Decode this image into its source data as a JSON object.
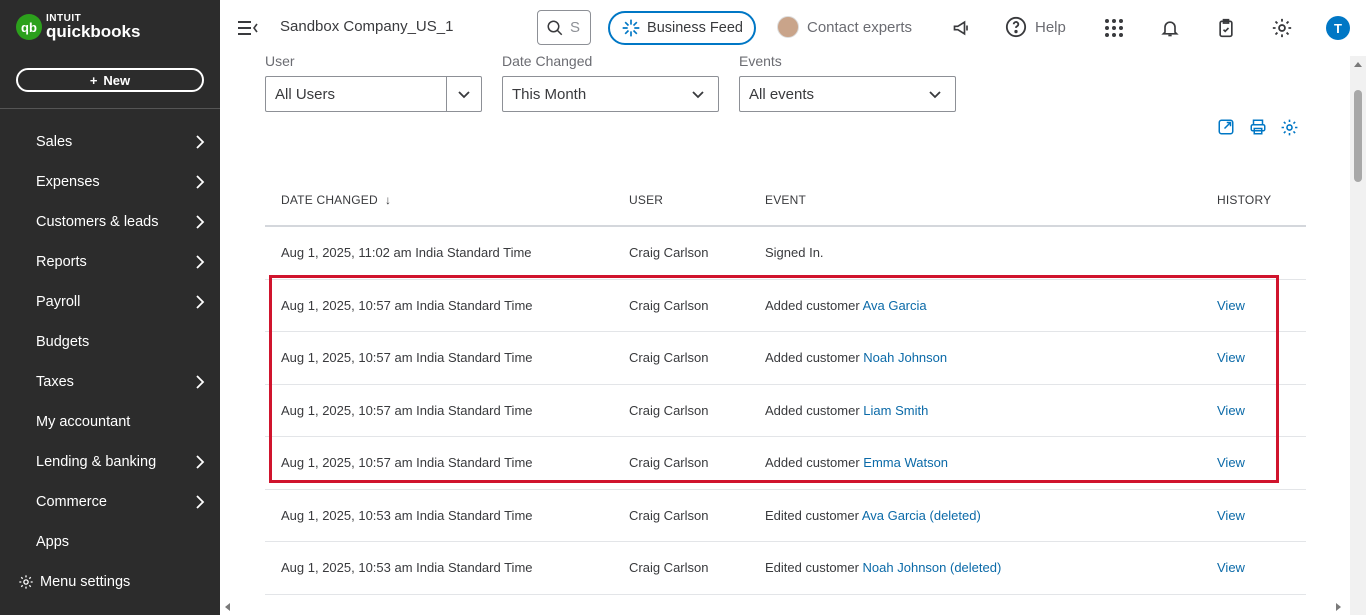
{
  "brand": {
    "logo_mark": "qb",
    "logo_intuit": "INTUIT",
    "logo_name": "quickbooks"
  },
  "sidebar": {
    "new_label": "New",
    "items": [
      {
        "label": "Sales",
        "chevron": true
      },
      {
        "label": "Expenses",
        "chevron": true
      },
      {
        "label": "Customers & leads",
        "chevron": true
      },
      {
        "label": "Reports",
        "chevron": true
      },
      {
        "label": "Payroll",
        "chevron": true
      },
      {
        "label": "Budgets",
        "chevron": false
      },
      {
        "label": "Taxes",
        "chevron": true
      },
      {
        "label": "My accountant",
        "chevron": false
      },
      {
        "label": "Lending & banking",
        "chevron": true
      },
      {
        "label": "Commerce",
        "chevron": true
      },
      {
        "label": "Apps",
        "chevron": false
      }
    ],
    "menu_settings": "Menu settings"
  },
  "header": {
    "company": "Sandbox Company_US_1",
    "search_placeholder": "S",
    "business_feed": "Business Feed",
    "contact_experts": "Contact experts",
    "help": "Help",
    "user_initial": "T"
  },
  "filters": {
    "user_label": "User",
    "user_value": "All Users",
    "date_label": "Date Changed",
    "date_value": "This Month",
    "events_label": "Events",
    "events_value": "All events"
  },
  "table": {
    "headers": {
      "date": "DATE CHANGED",
      "sort_arrow": "↓",
      "user": "USER",
      "event": "EVENT",
      "history": "HISTORY"
    },
    "rows": [
      {
        "date": "Aug 1, 2025, 11:02 am India Standard Time",
        "user": "Craig Carlson",
        "event_prefix": "Signed In.",
        "event_link": "",
        "history": ""
      },
      {
        "date": "Aug 1, 2025, 10:57 am India Standard Time",
        "user": "Craig Carlson",
        "event_prefix": "Added customer ",
        "event_link": "Ava Garcia",
        "history": "View"
      },
      {
        "date": "Aug 1, 2025, 10:57 am India Standard Time",
        "user": "Craig Carlson",
        "event_prefix": "Added customer ",
        "event_link": "Noah Johnson",
        "history": "View"
      },
      {
        "date": "Aug 1, 2025, 10:57 am India Standard Time",
        "user": "Craig Carlson",
        "event_prefix": "Added customer ",
        "event_link": "Liam Smith",
        "history": "View"
      },
      {
        "date": "Aug 1, 2025, 10:57 am India Standard Time",
        "user": "Craig Carlson",
        "event_prefix": "Added customer ",
        "event_link": "Emma Watson",
        "history": "View"
      },
      {
        "date": "Aug 1, 2025, 10:53 am India Standard Time",
        "user": "Craig Carlson",
        "event_prefix": "Edited customer ",
        "event_link": "Ava Garcia (deleted)",
        "history": "View"
      },
      {
        "date": "Aug 1, 2025, 10:53 am India Standard Time",
        "user": "Craig Carlson",
        "event_prefix": "Edited customer ",
        "event_link": "Noah Johnson (deleted)",
        "history": "View"
      }
    ]
  },
  "colors": {
    "sidebar_bg": "#2c2c2c",
    "brand_green": "#2ca01c",
    "accent_blue": "#0077c5",
    "link": "#0b6aa8",
    "highlight_red": "#d0142d"
  }
}
